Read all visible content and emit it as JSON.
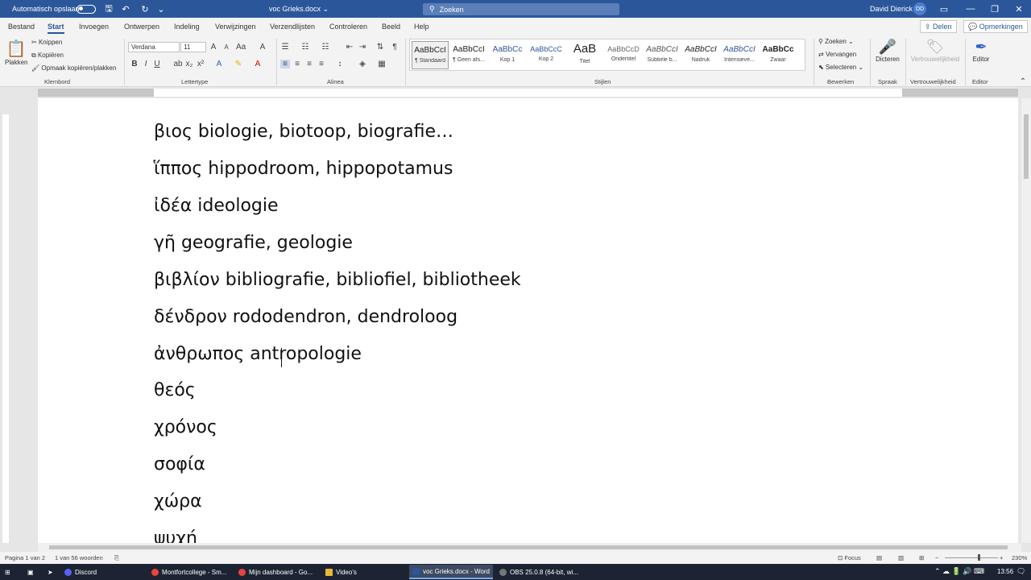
{
  "titlebar": {
    "autosave_label": "Automatisch opslaan",
    "doc_title": "voc Grieks.docx",
    "search_label": "Zoeken",
    "user_name": "David Dierick",
    "user_initials": "DD"
  },
  "tabs": [
    "Bestand",
    "Start",
    "Invoegen",
    "Ontwerpen",
    "Indeling",
    "Verwijzingen",
    "Verzendlijsten",
    "Controleren",
    "Beeld",
    "Help"
  ],
  "active_tab": "Start",
  "share": {
    "label": "Delen",
    "comments": "Opmerkingen"
  },
  "ribbon": {
    "clipboard": {
      "paste": "Plakken",
      "cut": "Knippen",
      "copy": "Kopiëren",
      "format_painter": "Opmaak kopiëren/plakken",
      "group": "Klembord"
    },
    "font": {
      "name": "Verdana",
      "size": "11",
      "group": "Lettertype"
    },
    "paragraph": {
      "group": "Alinea"
    },
    "styles": {
      "items": [
        {
          "preview": "AaBbCcI",
          "name": "¶ Standaard"
        },
        {
          "preview": "AaBbCcI",
          "name": "¶ Geen afs..."
        },
        {
          "preview": "AaBbCc",
          "name": "Kop 1"
        },
        {
          "preview": "AaBbCcC",
          "name": "Kop 2"
        },
        {
          "preview": "AaB",
          "name": "Titel"
        },
        {
          "preview": "AaBbCcD",
          "name": "Ondertitel"
        },
        {
          "preview": "AaBbCcI",
          "name": "Subtiele b..."
        },
        {
          "preview": "AaBbCcI",
          "name": "Nadruk"
        },
        {
          "preview": "AaBbCcI",
          "name": "Intensieve..."
        },
        {
          "preview": "AaBbCc",
          "name": "Zwaar"
        }
      ],
      "group": "Stijlen"
    },
    "editing": {
      "find": "Zoeken",
      "replace": "Vervangen",
      "select": "Selecteren",
      "group": "Bewerken"
    },
    "voice": {
      "dictate": "Dicteren",
      "group": "Spraak"
    },
    "sensitivity": {
      "label": "Vertrouwelijkheid",
      "group": "Vertrouwelijkheid"
    },
    "editor": {
      "label": "Editor",
      "group": "Editor"
    }
  },
  "document": {
    "lines": [
      "βιος biologie, biotoop, biografie…",
      "ἵππος hippodroom, hippopotamus",
      "ἰδέα ideologie",
      "γῆ geografie, geologie",
      "βιβλίον bibliografie, bibliofiel, bibliotheek",
      "δένδρον rododendron, dendroloog",
      "ἀνθρωπος antropologie",
      "θεός",
      "χρόνος",
      "σοφία",
      "χώρα",
      "ψυχή"
    ]
  },
  "status": {
    "page": "Pagina 1 van 2",
    "words": "1 van 56 woorden",
    "focus": "Focus",
    "zoom": "230%"
  },
  "taskbar": {
    "apps": [
      "Discord",
      "Montfortcollege - Sm...",
      "Mijn dashboard - Go...",
      "Video's",
      "voc Grieks.docx - Word",
      "OBS 25.0.8 (64-bit, wi..."
    ],
    "active_app": "voc Grieks.docx - Word",
    "time": "13:56"
  }
}
